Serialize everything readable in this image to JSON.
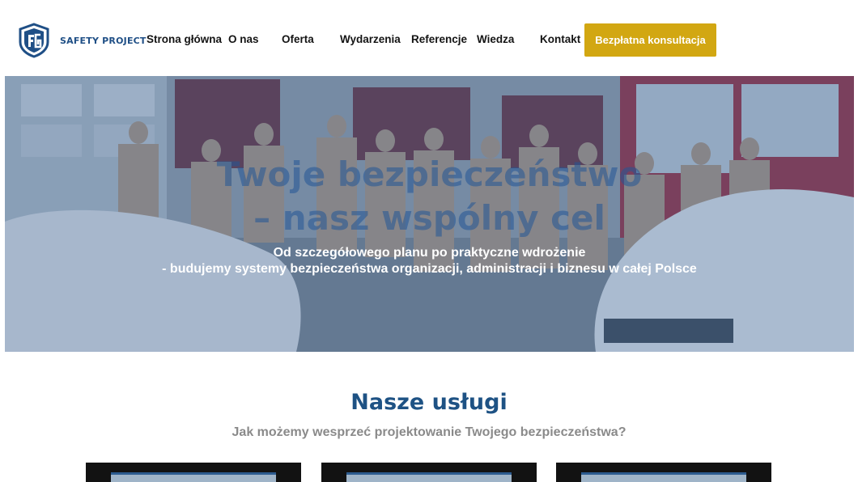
{
  "brand": {
    "name": "SAFETY PROJECT",
    "colors": {
      "primary": "#1f4f86",
      "accent": "#d2a712"
    }
  },
  "nav": {
    "items": [
      "Strona główna",
      "O nas",
      "Oferta",
      "Wydarzenia",
      "Referencje",
      "Wiedza",
      "Kontakt"
    ],
    "cta_label": "Bezpłatna konsultacja"
  },
  "hero": {
    "title_line1": "Twoje bezpieczeństwo",
    "title_line2": "– nasz wspólny cel",
    "subtitle_line1": "Od szczegółowego planu po praktyczne wdrożenie",
    "subtitle_line2": "- budujemy systemy bezpieczeństwa organizacji, administracji i biznesu w całej Polsce"
  },
  "services": {
    "title": "Nasze usługi",
    "subtitle": "Jak możemy wesprzeć projektowanie Twojego bezpieczeństwa?"
  }
}
